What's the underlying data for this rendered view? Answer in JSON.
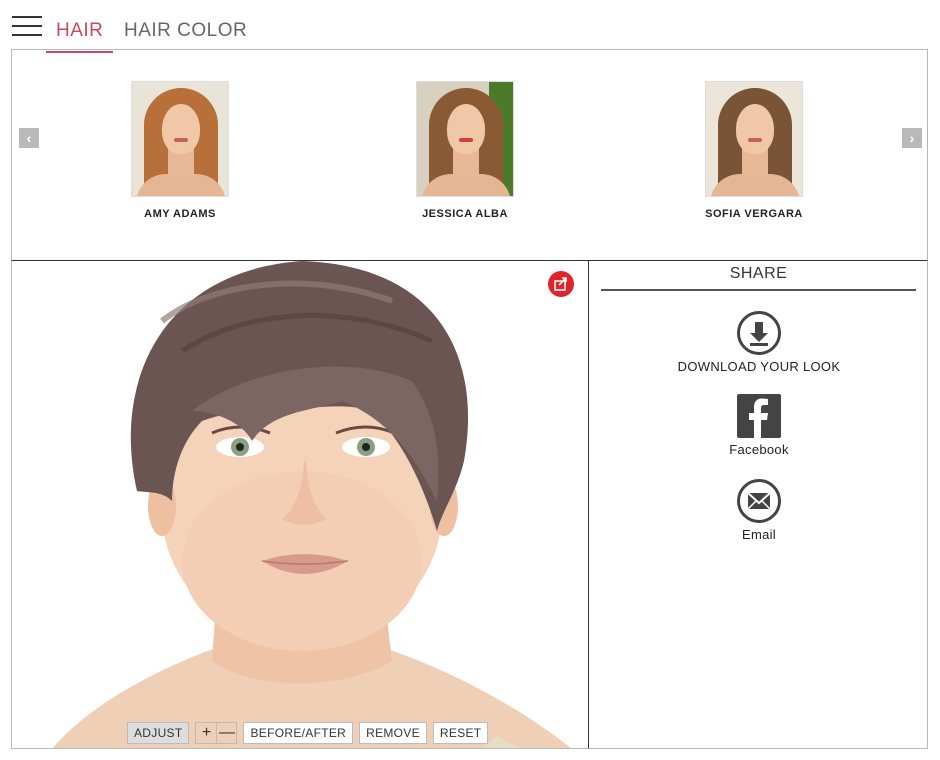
{
  "nav": {
    "tabs": [
      {
        "label": "HAIR",
        "active": true
      },
      {
        "label": "HAIR COLOR",
        "active": false
      }
    ],
    "accent_color": "#c9485b"
  },
  "carousel": {
    "prev_label": "‹",
    "next_label": "›",
    "celebrities": [
      {
        "name": "AMY ADAMS"
      },
      {
        "name": "JESSICA ALBA"
      },
      {
        "name": "SOFIA VERGARA"
      }
    ]
  },
  "toolbar": {
    "adjust": "ADJUST",
    "zoom_in": "+",
    "zoom_out": "—",
    "before_after": "BEFORE/AFTER",
    "remove": "REMOVE",
    "reset": "RESET"
  },
  "share": {
    "title": "SHARE",
    "download_label": "DOWNLOAD YOUR LOOK",
    "facebook_label": "Facebook",
    "email_label": "Email",
    "badge_color": "#e2232a"
  }
}
